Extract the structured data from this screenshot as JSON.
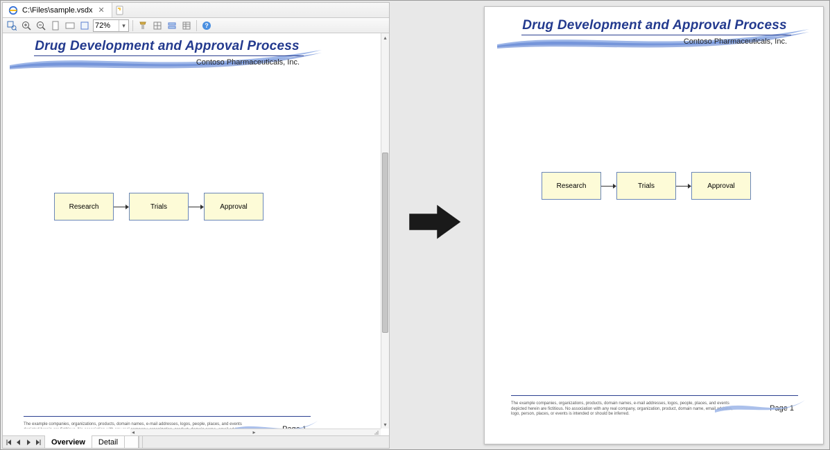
{
  "colors": {
    "brand_blue": "#233a8e",
    "swoosh_light": "#9db6e8",
    "swoosh_dark": "#5a7fd0",
    "node_fill": "#fdfbd7",
    "node_border": "#6a86b8"
  },
  "app": {
    "tab_title": "C:\\Files\\sample.vsdx",
    "zoom_value": "72%",
    "page_tabs": {
      "active": "Overview",
      "other": "Detail"
    }
  },
  "document": {
    "title": "Drug Development and Approval Process",
    "subtitle": "Contoso Pharmaceuticals, Inc.",
    "flow": [
      "Research",
      "Trials",
      "Approval"
    ],
    "disclaimer": "The example companies, organizations, products, domain names, e-mail addresses, logos, people, places, and events depicted herein are fictitious. No association with any real company, organization, product, domain name, email address, logo, person, places, or events is intended or should be inferred.",
    "page_label": "Page 1"
  }
}
